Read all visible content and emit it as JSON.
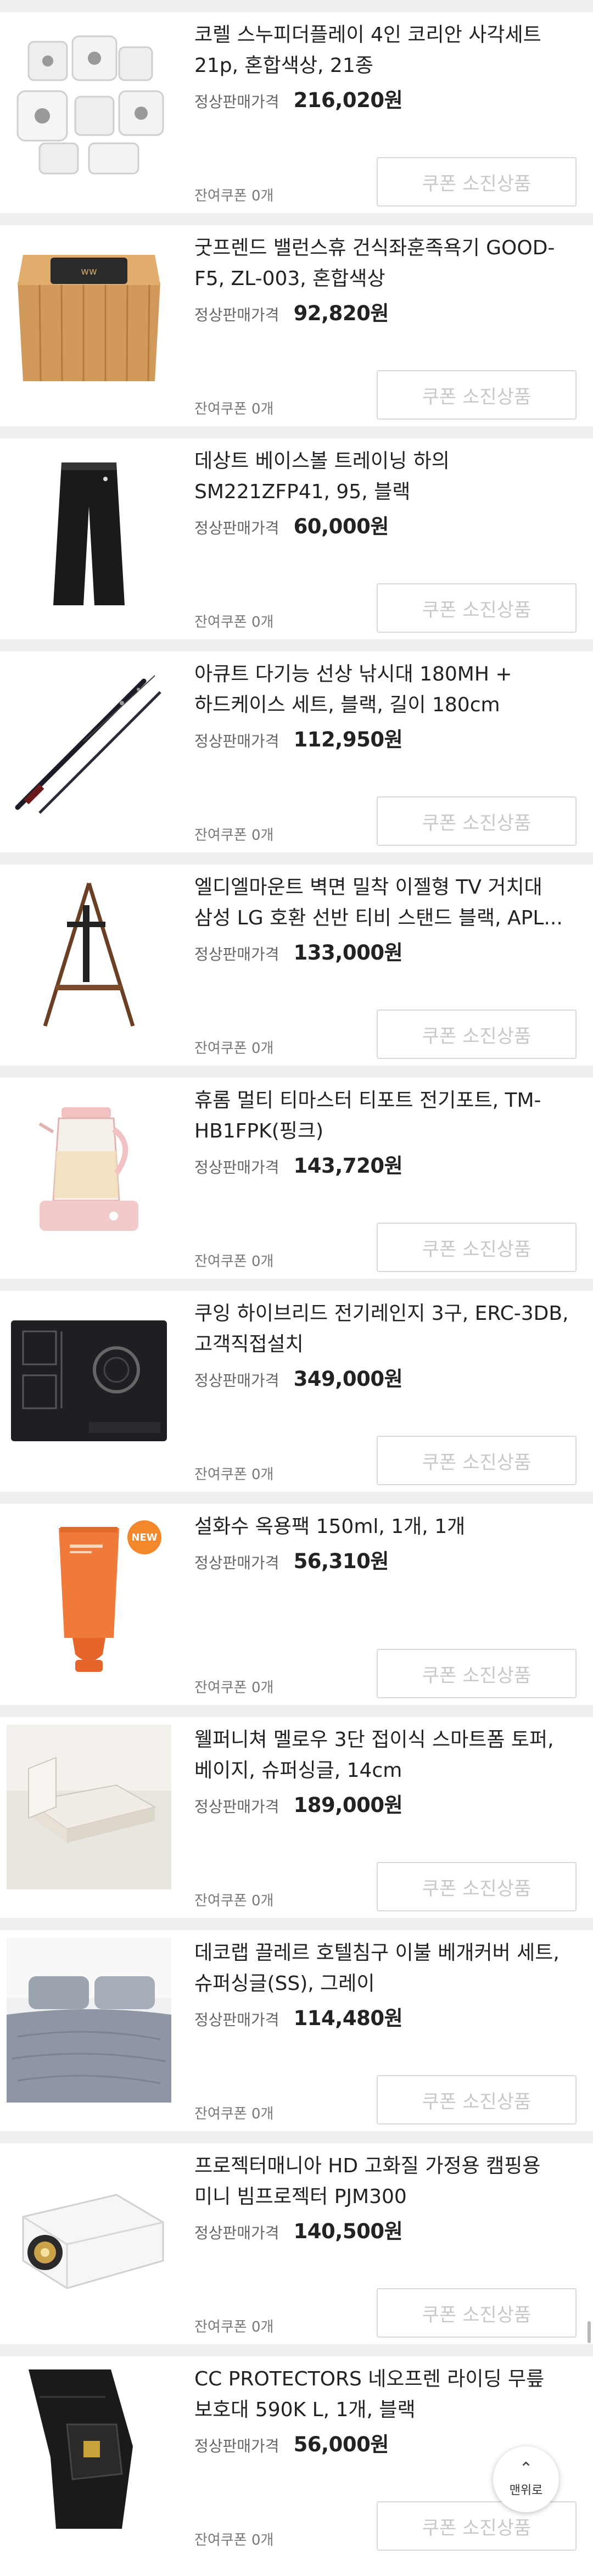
{
  "common": {
    "price_label": "정상판매가격",
    "coupon_label": "잔여쿠폰 0개",
    "button_label": "쿠폰 소진상품"
  },
  "products": [
    {
      "name": "코렐 스누피더플레이 4인 코리안 사각세트 21p, 혼합색상, 21종",
      "price": "216,020원"
    },
    {
      "name": "굿프렌드 밸런스휴 건식좌훈족욕기 GOOD-F5, ZL-003, 혼합색상",
      "price": "92,820원"
    },
    {
      "name": "데상트 베이스볼 트레이닝 하의 SM221ZFP41, 95, 블랙",
      "price": "60,000원"
    },
    {
      "name": "아큐트 다기능 선상 낚시대 180MH + 하드케이스 세트, 블랙, 길이 180cm",
      "price": "112,950원"
    },
    {
      "name": "엘디엘마운트 벽면 밀착 이젤형 TV 거치대 삼성 LG 호환 선반 티비 스탠드 블랙, APL...",
      "price": "133,000원"
    },
    {
      "name": "휴롬 멀티 티마스터 티포트 전기포트, TM-HB1FPK(핑크)",
      "price": "143,720원"
    },
    {
      "name": "쿠잉 하이브리드 전기레인지 3구, ERC-3DB, 고객직접설치",
      "price": "349,000원"
    },
    {
      "name": "설화수 옥용팩 150ml, 1개, 1개",
      "price": "56,310원",
      "badge": "NEW"
    },
    {
      "name": "웰퍼니쳐 멜로우 3단 접이식 스마트폼 토퍼, 베이지, 슈퍼싱글, 14cm",
      "price": "189,000원"
    },
    {
      "name": "데코랩 끌레르 호텔침구 이불 베개커버 세트, 슈퍼싱글(SS), 그레이",
      "price": "114,480원"
    },
    {
      "name": "프로젝터매니아 HD 고화질 가정용 캠핑용 미니 빔프로젝터 PJM300",
      "price": "140,500원"
    },
    {
      "name": "CC PROTECTORS 네오프렌 라이딩 무릎 보호대 590K L, 1개, 블랙",
      "price": "56,000원"
    }
  ],
  "top_button": {
    "label": "맨위로",
    "arrow": "⌃"
  },
  "colors": {
    "separator": "#efefef",
    "button_border": "#d9d9d9",
    "button_text": "#c8c8c8"
  }
}
